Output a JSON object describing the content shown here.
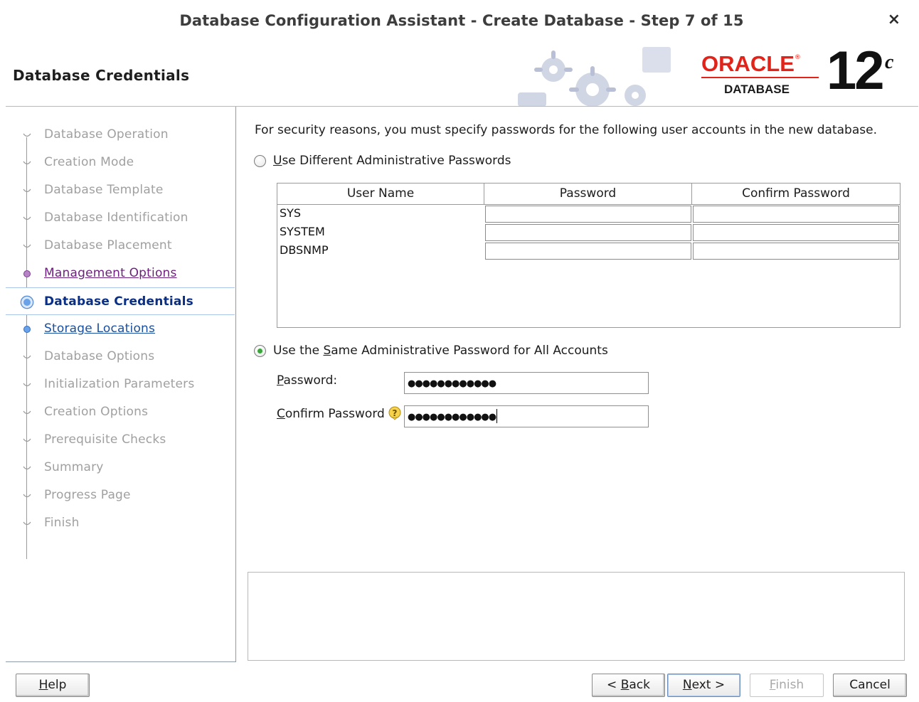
{
  "window": {
    "title": "Database Configuration Assistant - Create Database - Step 7 of 15",
    "close_glyph": "×"
  },
  "header": {
    "page_title": "Database Credentials",
    "logo": {
      "oracle": "ORACLE",
      "registered": "®",
      "database": "DATABASE",
      "version": "12",
      "suffix": "c"
    }
  },
  "nav": {
    "items": [
      {
        "label": "Database Operation",
        "state": "inactive"
      },
      {
        "label": "Creation Mode",
        "state": "inactive"
      },
      {
        "label": "Database Template",
        "state": "inactive"
      },
      {
        "label": "Database Identification",
        "state": "inactive"
      },
      {
        "label": "Database Placement",
        "state": "inactive"
      },
      {
        "label": "Management Options",
        "state": "done"
      },
      {
        "label": "Database Credentials",
        "state": "current"
      },
      {
        "label": "Storage Locations",
        "state": "next"
      },
      {
        "label": "Database Options",
        "state": "inactive"
      },
      {
        "label": "Initialization Parameters",
        "state": "inactive"
      },
      {
        "label": "Creation Options",
        "state": "inactive"
      },
      {
        "label": "Prerequisite Checks",
        "state": "inactive"
      },
      {
        "label": "Summary",
        "state": "inactive"
      },
      {
        "label": "Progress Page",
        "state": "inactive"
      },
      {
        "label": "Finish",
        "state": "inactive"
      }
    ]
  },
  "main": {
    "intro": "For security reasons, you must specify passwords for the following user accounts in the new database.",
    "option_different": {
      "mnemonic": "U",
      "rest": "se Different Administrative Passwords",
      "selected": false
    },
    "table": {
      "headers": [
        "User Name",
        "Password",
        "Confirm Password"
      ],
      "rows": [
        {
          "user": "SYS",
          "password": "",
          "confirm": ""
        },
        {
          "user": "SYSTEM",
          "password": "",
          "confirm": ""
        },
        {
          "user": "DBSNMP",
          "password": "",
          "confirm": ""
        }
      ]
    },
    "option_same": {
      "before": "Use the ",
      "mnemonic": "S",
      "rest": "ame Administrative Password for All Accounts",
      "selected": true
    },
    "password": {
      "mnemonic": "P",
      "rest": "assword:",
      "value": "●●●●●●●●●●●●"
    },
    "confirm": {
      "mnemonic": "C",
      "rest": "onfirm Password",
      "value": "●●●●●●●●●●●●"
    }
  },
  "buttons": {
    "help": {
      "mnemonic": "H",
      "rest": "elp"
    },
    "back": {
      "before": "< ",
      "mnemonic": "B",
      "rest": "ack"
    },
    "next": {
      "mnemonic": "N",
      "rest": "ext >"
    },
    "finish": {
      "mnemonic": "F",
      "rest": "inish"
    },
    "cancel": {
      "label": "Cancel"
    }
  },
  "colors": {
    "nav_done": "#6d1f7e",
    "nav_current": "#0a2f86",
    "nav_next": "#1a4fa0",
    "nav_inactive": "#a0a0a0",
    "oracle_red": "#e2231a",
    "radio_selected": "#3aa53a"
  }
}
